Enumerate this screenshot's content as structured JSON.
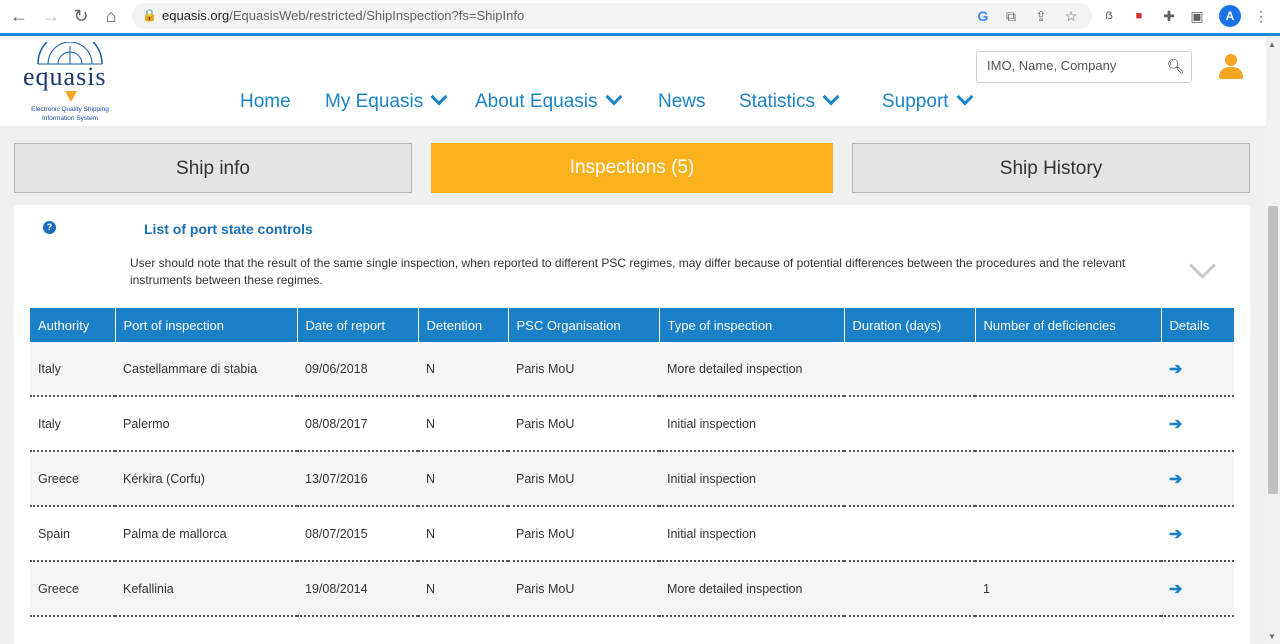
{
  "browser": {
    "url_host": "equasis.org",
    "url_path": "/EquasisWeb/restricted/ShipInspection?fs=ShipInfo",
    "profile_initial": "A"
  },
  "logo": {
    "word": "equasis",
    "subtitle_line1": "Electronic Quality Shipping",
    "subtitle_line2": "Information System"
  },
  "nav": {
    "home": "Home",
    "my_equasis": "My Equasis",
    "about": "About Equasis",
    "news": "News",
    "statistics": "Statistics",
    "support": "Support"
  },
  "search": {
    "placeholder": "IMO, Name, Company"
  },
  "tabs": {
    "ship_info": "Ship info",
    "inspections": "Inspections (5)",
    "ship_history": "Ship History"
  },
  "section": {
    "title": "List of port state controls",
    "note": "User should note that the result of the same single inspection, when reported to different PSC regimes, may differ because of potential differences between the procedures and the relevant instruments between these regimes."
  },
  "table": {
    "headers": [
      "Authority",
      "Port of inspection",
      "Date of report",
      "Detention",
      "PSC Organisation",
      "Type of inspection",
      "Duration (days)",
      "Number of deficiencies",
      "Details"
    ],
    "rows": [
      [
        "Italy",
        "Castellammare di stabia",
        "09/06/2018",
        "N",
        "Paris MoU",
        "More detailed inspection",
        "",
        ""
      ],
      [
        "Italy",
        "Palermo",
        "08/08/2017",
        "N",
        "Paris MoU",
        "Initial inspection",
        "",
        ""
      ],
      [
        "Greece",
        "Kérkira (Corfu)",
        "13/07/2016",
        "N",
        "Paris MoU",
        "Initial inspection",
        "",
        ""
      ],
      [
        "Spain",
        "Palma de mallorca",
        "08/07/2015",
        "N",
        "Paris MoU",
        "Initial inspection",
        "",
        ""
      ],
      [
        "Greece",
        "Kefallinia",
        "19/08/2014",
        "N",
        "Paris MoU",
        "More detailed inspection",
        "",
        "1"
      ]
    ]
  },
  "colors": {
    "accent_blue": "#1a80c8",
    "active_tab": "#fbb21d"
  }
}
